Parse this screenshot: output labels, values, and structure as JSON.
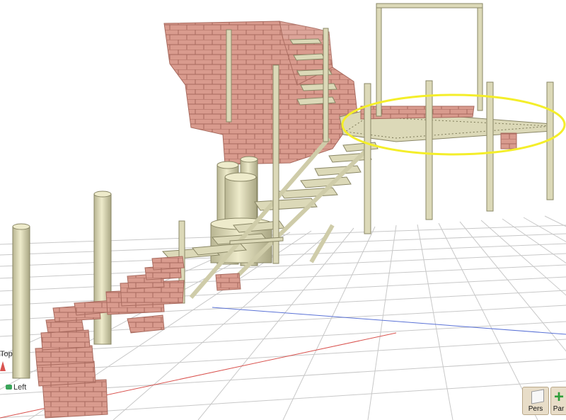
{
  "viewport": {
    "axis_top_label": "Top",
    "axis_left_label": "Left"
  },
  "toolbar": {
    "perspective_label": "Pers",
    "add_label": "Par"
  },
  "colors": {
    "grid": "#c8c8c8",
    "grid_major": "#8a8a8a",
    "axis_red": "#d9534f",
    "axis_blue": "#5a72d6",
    "brick": "#d99b8e",
    "brick_dark": "#a86a5e",
    "steel": "#dcd9b8",
    "steel_dark": "#8a8766",
    "highlight": "#f4ee2a"
  }
}
